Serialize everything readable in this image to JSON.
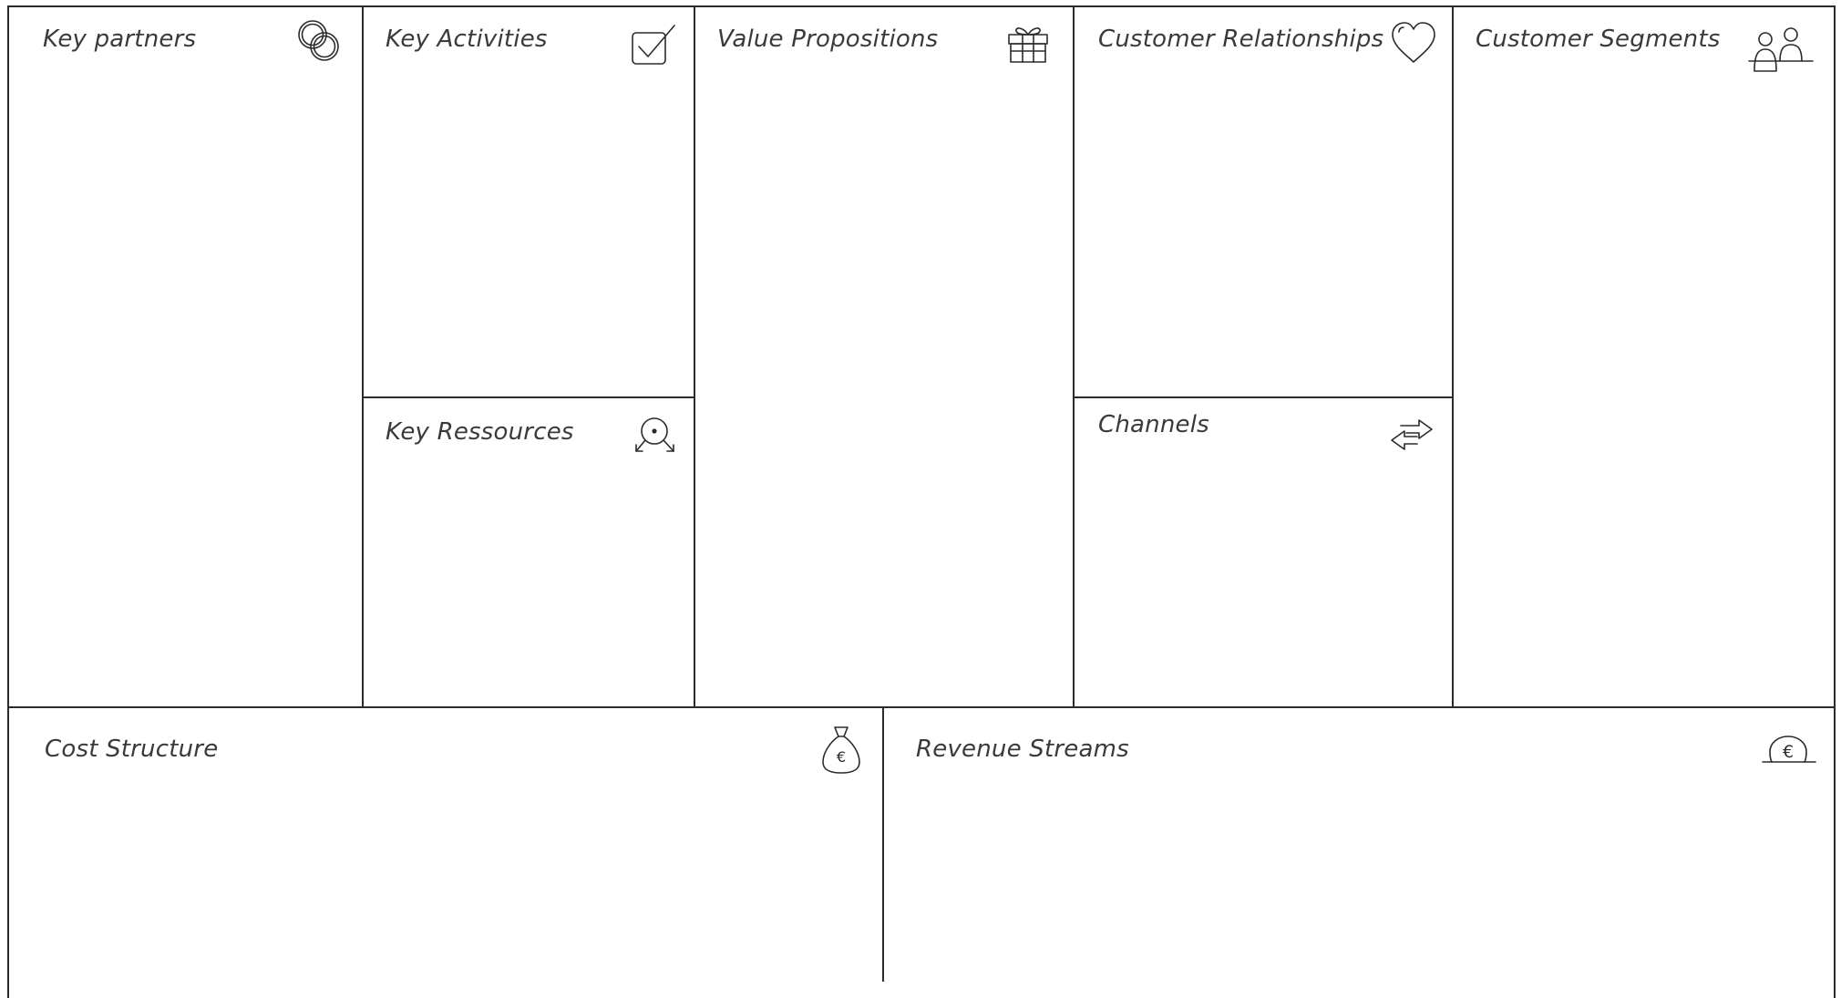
{
  "canvas": {
    "sections": {
      "key_partners": {
        "title": "Key partners",
        "icon": "rings-icon"
      },
      "key_activities": {
        "title": "Key Activities",
        "icon": "checkbox-icon"
      },
      "key_resources": {
        "title": "Key Ressources",
        "icon": "resources-icon"
      },
      "value_propositions": {
        "title": "Value Propositions",
        "icon": "gift-icon"
      },
      "customer_relationships": {
        "title": "Customer Relationships",
        "icon": "heart-icon"
      },
      "channels": {
        "title": "Channels",
        "icon": "arrows-exchange-icon"
      },
      "customer_segments": {
        "title": "Customer Segments",
        "icon": "people-icon"
      },
      "cost_structure": {
        "title": "Cost Structure",
        "icon": "money-bag-icon"
      },
      "revenue_streams": {
        "title": "Revenue Streams",
        "icon": "euro-coin-icon"
      }
    },
    "line_color": "#2b2b2b",
    "text_color": "#3a3a3a",
    "background": "#ffffff"
  }
}
